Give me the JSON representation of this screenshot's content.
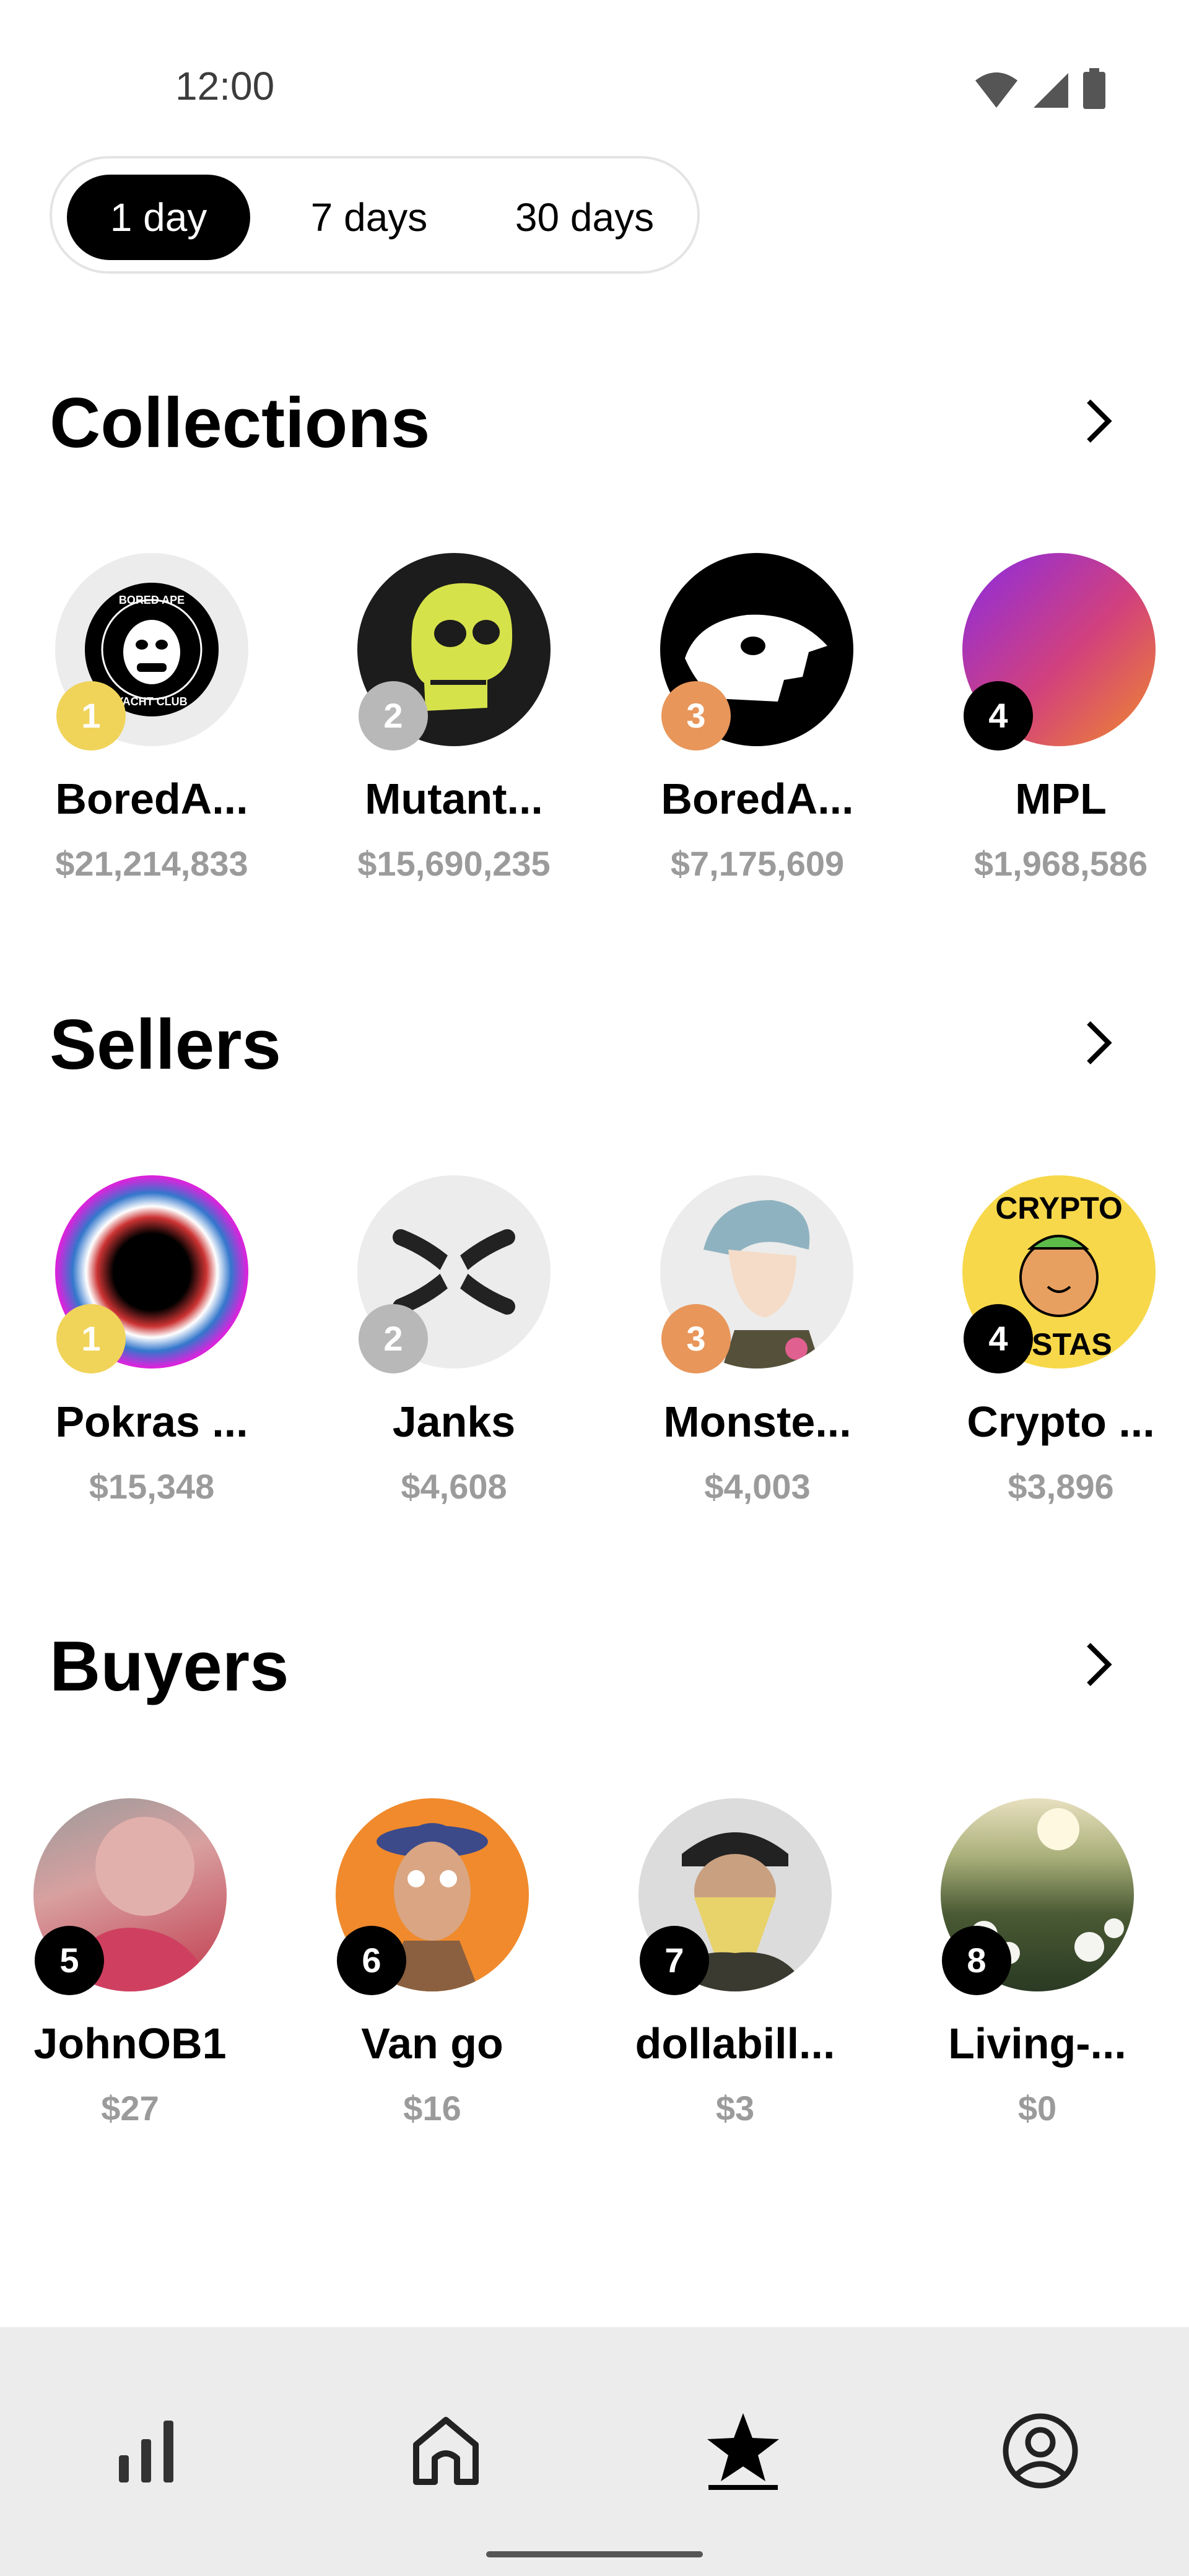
{
  "status_bar": {
    "time": "12:00"
  },
  "range_tabs": [
    {
      "label": "1 day",
      "active": true
    },
    {
      "label": "7 days",
      "active": false
    },
    {
      "label": "30 days",
      "active": false
    }
  ],
  "collections": {
    "title": "Collections",
    "items": [
      {
        "rank": "1",
        "name": "BoredA...",
        "value": "$21,214,833"
      },
      {
        "rank": "2",
        "name": "Mutant...",
        "value": "$15,690,235"
      },
      {
        "rank": "3",
        "name": "BoredA...",
        "value": "$7,175,609"
      },
      {
        "rank": "4",
        "name": "MPL",
        "value": "$1,968,586"
      }
    ]
  },
  "sellers": {
    "title": "Sellers",
    "items": [
      {
        "rank": "1",
        "name": "Pokras ...",
        "value": "$15,348"
      },
      {
        "rank": "2",
        "name": "Janks",
        "value": "$4,608"
      },
      {
        "rank": "3",
        "name": "Monste...",
        "value": "$4,003"
      },
      {
        "rank": "4",
        "name": "Crypto ...",
        "value": "$3,896"
      }
    ]
  },
  "buyers": {
    "title": "Buyers",
    "items": [
      {
        "rank": "5",
        "name": "JohnOB1",
        "value": "$27"
      },
      {
        "rank": "6",
        "name": "Van go",
        "value": "$16"
      },
      {
        "rank": "7",
        "name": "dollabill...",
        "value": "$3"
      },
      {
        "rank": "8",
        "name": "Living-...",
        "value": "$0"
      }
    ]
  },
  "logos": {
    "bayc_top": "BORED APE",
    "bayc_bottom": "YACHT CLUB",
    "crypto_top": "CRYPTO",
    "crypto_bottom": "ISTAS"
  },
  "colors": {
    "rank_gold": "#f0d45a",
    "rank_silver": "#b8b8b8",
    "rank_bronze": "#e8965a",
    "rank_default": "#000000",
    "muted_text": "#9b9b9b",
    "nav_bg": "#ececec"
  },
  "bottom_nav": [
    {
      "icon": "stats-icon",
      "active": false
    },
    {
      "icon": "home-icon",
      "active": false
    },
    {
      "icon": "star-icon",
      "active": true
    },
    {
      "icon": "profile-icon",
      "active": false
    }
  ]
}
